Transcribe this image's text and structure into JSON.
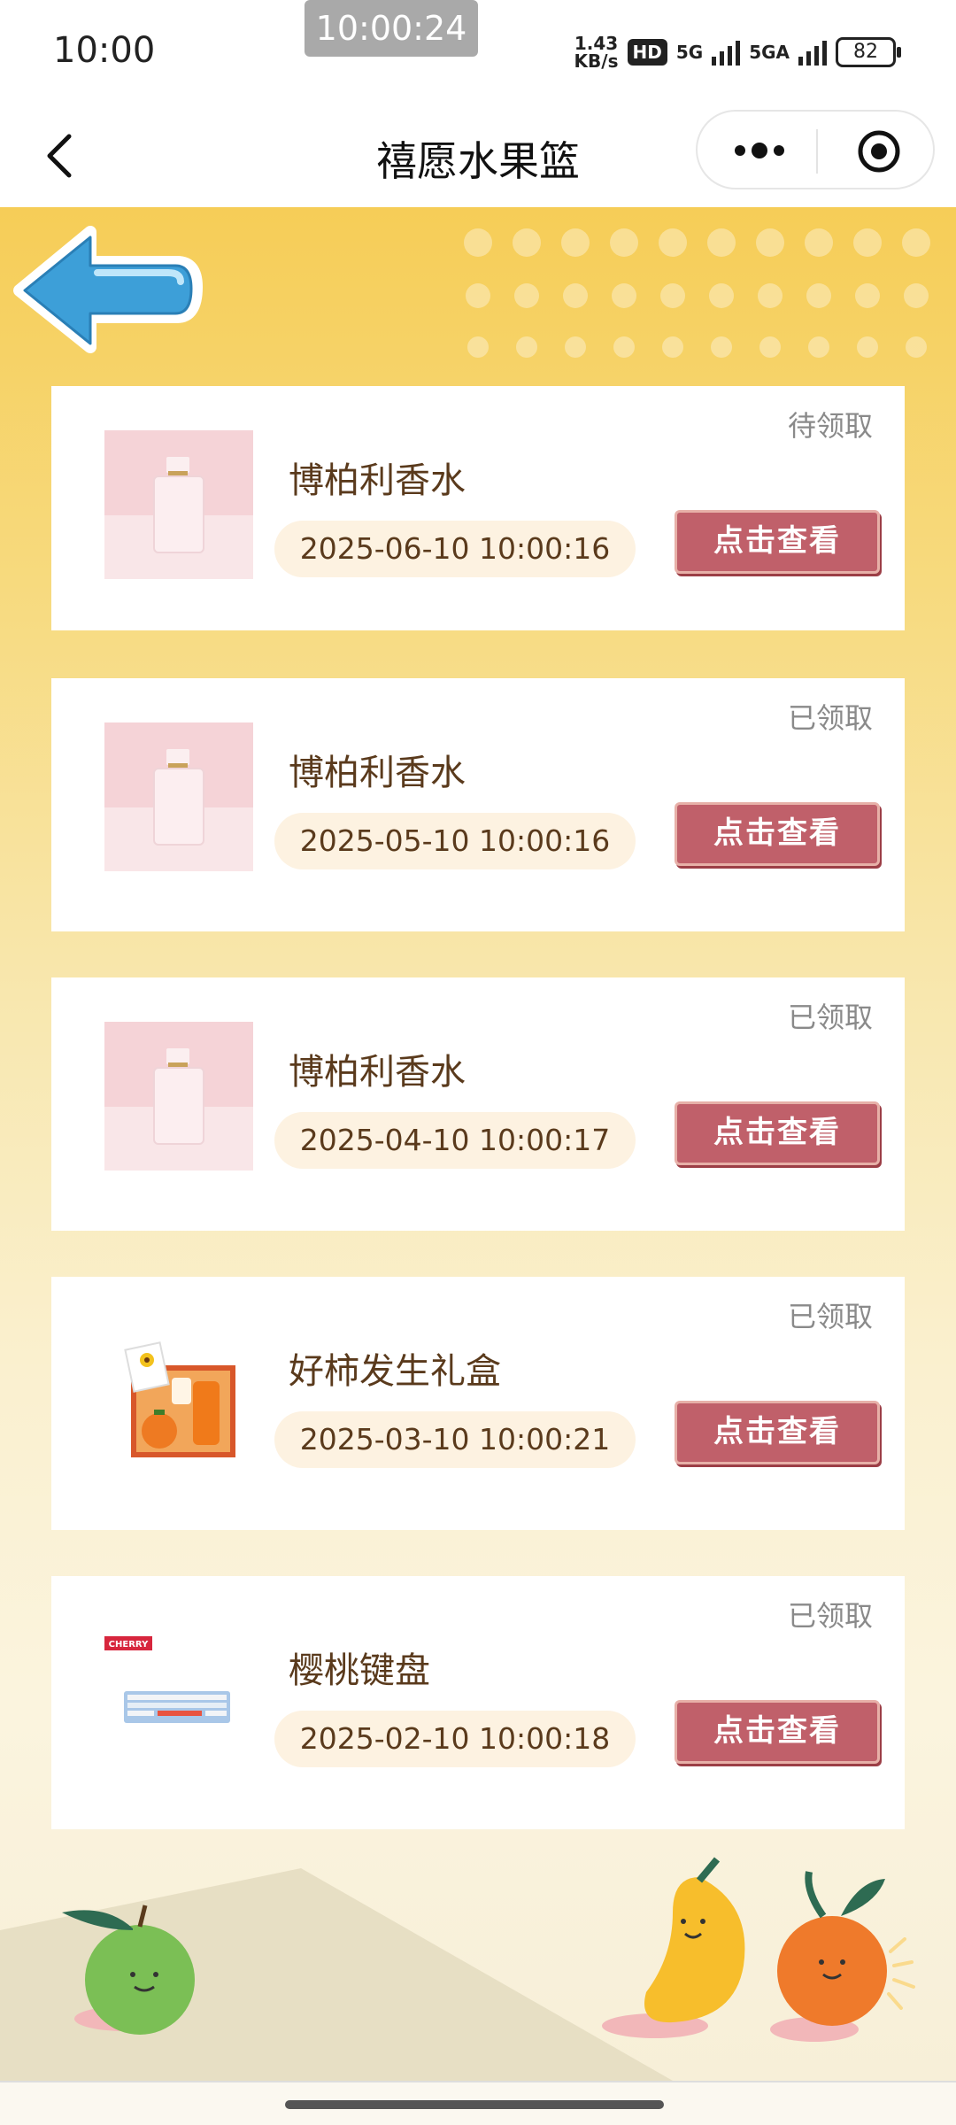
{
  "status_bar": {
    "time": "10:00",
    "screen_record_time": "10:00:24",
    "speed_value": "1.43",
    "speed_unit": "KB/s",
    "hd_badge": "HD",
    "network_1": "5G",
    "network_2": "5GA",
    "battery": "82"
  },
  "nav": {
    "title": "禧愿水果篮"
  },
  "items": [
    {
      "name": "博柏利香水",
      "status": "待领取",
      "date": "2025-06-10 10:00:16",
      "button": "点击查看",
      "image": "perfume"
    },
    {
      "name": "博柏利香水",
      "status": "已领取",
      "date": "2025-05-10 10:00:16",
      "button": "点击查看",
      "image": "perfume"
    },
    {
      "name": "博柏利香水",
      "status": "已领取",
      "date": "2025-04-10 10:00:17",
      "button": "点击查看",
      "image": "perfume"
    },
    {
      "name": "好柿发生礼盒",
      "status": "已领取",
      "date": "2025-03-10 10:00:21",
      "button": "点击查看",
      "image": "gift-box"
    },
    {
      "name": "樱桃键盘",
      "status": "已领取",
      "date": "2025-02-10 10:00:18",
      "button": "点击查看",
      "image": "keyboard"
    }
  ],
  "keyboard_brand": "CHERRY",
  "colors": {
    "button": "#c0606a",
    "date_pill": "#fdf2e1",
    "background_top": "#f6cd57",
    "text_brown": "#5a3a1c"
  }
}
